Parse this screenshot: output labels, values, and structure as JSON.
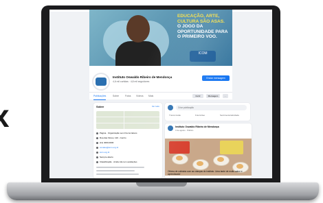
{
  "marker": "x",
  "cover": {
    "headline_lines": [
      "EDUCAÇÃO, ARTE,",
      "CULTURA SÃO ASAS."
    ],
    "headline_white": [
      "O JOGO DA",
      "OPORTUNIDADE PARA",
      "O PRIMEIRO VOO."
    ],
    "logo_text": "ICOM"
  },
  "page": {
    "name": "Instituto Oswaldo Ribeiro de Mendonça",
    "meta": "4,6 mil curtidas · 4,8 mil seguidores",
    "primary_button": "Enviar mensagem"
  },
  "tabs": {
    "items": [
      "Publicações",
      "Sobre",
      "Fotos",
      "Vídeos",
      "Mais"
    ],
    "like_button": "Curtir",
    "message_button": "Mensagem",
    "more_button": "···"
  },
  "intro": {
    "title": "Sobre",
    "link": "Ver tudo",
    "rows": [
      "Página · Organização sem fins lucrativos",
      "Rua das Flores, 120 - Centro",
      "(11) 4000-0000",
      "contato@iorm.org.br",
      "iorm.org.br",
      "Sempre aberto",
      "Classificação · Ainda não tem avaliações"
    ]
  },
  "composer": {
    "placeholder": "Criar publicação",
    "actions": [
      "Transmissão",
      "Foto/vídeo",
      "Sentimento/atividade"
    ]
  },
  "post": {
    "author": "Instituto Oswaldo Ribeiro de Mendonça",
    "time": "3 de agosto · Público",
    "caption": "Oficina de culinária com as crianças do instituto. Uma tarde de muito sabor e aprendizado!",
    "reactions": "42 curtidas · 3 comentários"
  }
}
